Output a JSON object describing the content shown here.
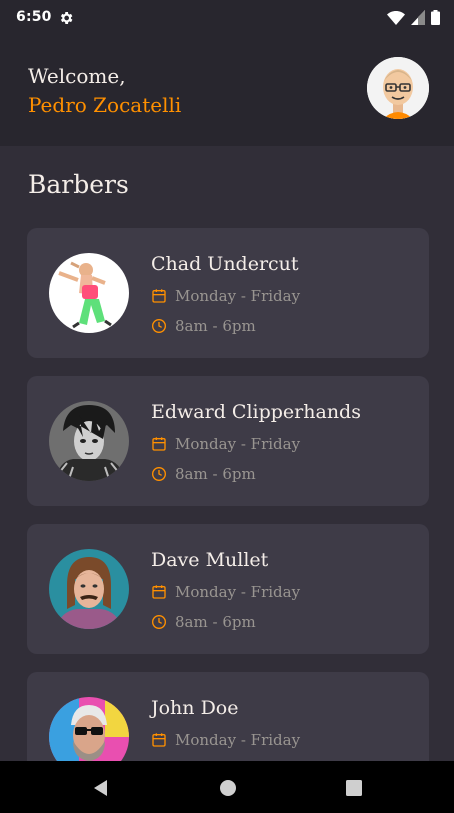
{
  "status_bar": {
    "time": "6:50",
    "icons": [
      "settings-gear-icon",
      "wifi-icon",
      "signal-icon",
      "battery-icon"
    ]
  },
  "header": {
    "welcome": "Welcome,",
    "user_name": "Pedro Zocatelli",
    "avatar": "user-avatar-icon"
  },
  "section_title": "Barbers",
  "barbers": [
    {
      "name": "Chad Undercut",
      "days": "Monday - Friday",
      "hours": "8am - 6pm"
    },
    {
      "name": "Edward Clipperhands",
      "days": "Monday - Friday",
      "hours": "8am - 6pm"
    },
    {
      "name": "Dave Mullet",
      "days": "Monday - Friday",
      "hours": "8am - 6pm"
    },
    {
      "name": "John Doe",
      "days": "Monday - Friday",
      "hours": ""
    }
  ],
  "nav": {
    "buttons": [
      "back-icon",
      "home-icon",
      "recents-icon"
    ]
  },
  "colors": {
    "accent": "#ff9000",
    "background": "#312e38",
    "header_bg": "#28262e",
    "card_bg": "#3e3b47",
    "text_primary": "#f4ede8",
    "text_secondary": "#999591"
  }
}
